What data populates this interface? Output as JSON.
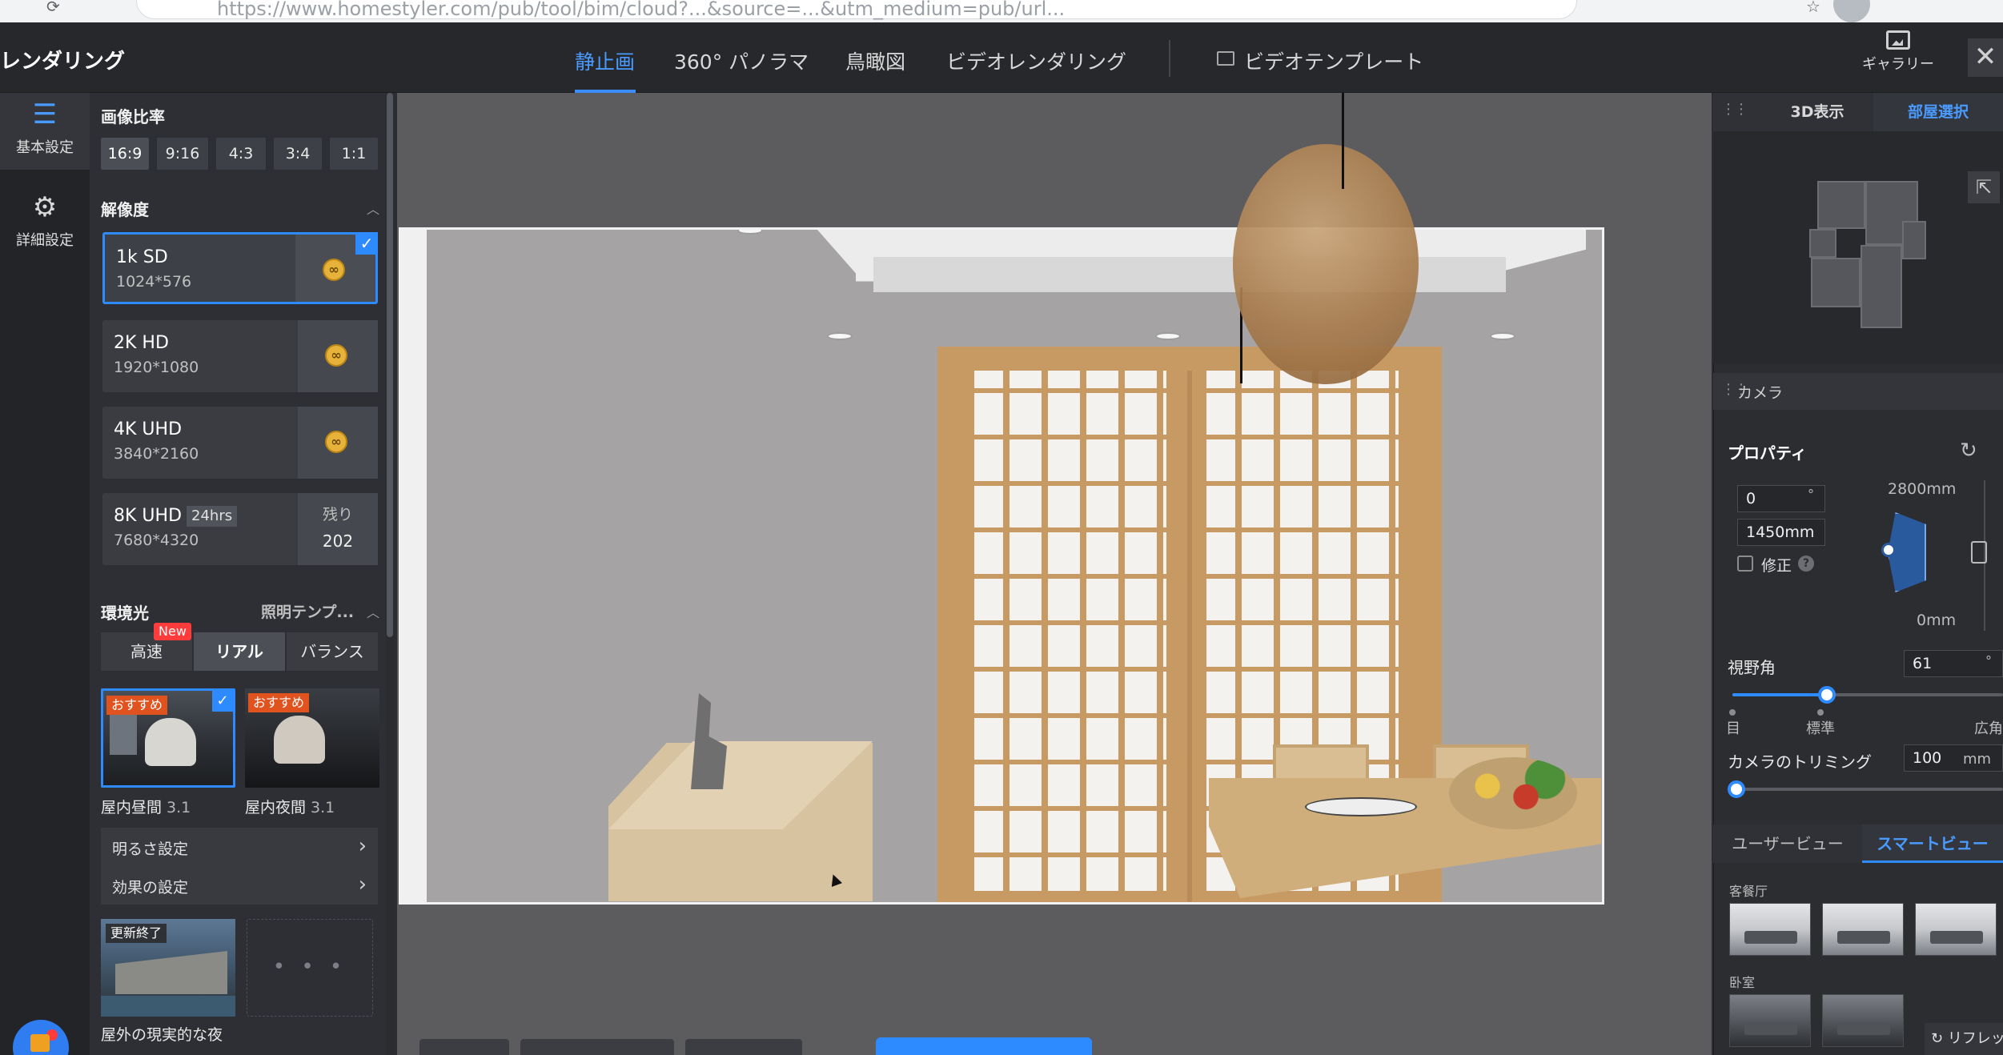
{
  "browser": {
    "url": "https://www.homestyler.com/pub/tool/bim/cloud?...&source=...&utm_medium=pub/url..."
  },
  "header": {
    "app_title": "レンダリング",
    "tabs": [
      "静止画",
      "360° パノラマ",
      "鳥瞰図",
      "ビデオレンダリング",
      "ビデオテンプレート"
    ],
    "active_tab": "静止画",
    "gallery_label": "ギャラリー",
    "close_symbol": "✕"
  },
  "rail": {
    "items": [
      {
        "label": "基本設定",
        "icon": "sliders-icon",
        "glyph": "☰",
        "active": true
      },
      {
        "label": "詳細設定",
        "icon": "gear-icon",
        "glyph": "⚙",
        "active": false
      }
    ]
  },
  "aspect": {
    "title": "画像比率",
    "options": [
      "16:9",
      "9:16",
      "4:3",
      "3:4",
      "1:1"
    ],
    "selected": "16:9"
  },
  "resolution": {
    "title": "解像度",
    "options": [
      {
        "name": "1k SD",
        "dims": "1024*576",
        "selected": true
      },
      {
        "name": "2K HD",
        "dims": "1920*1080",
        "selected": false
      },
      {
        "name": "4K UHD",
        "dims": "3840*2160",
        "selected": false
      },
      {
        "name": "8K UHD",
        "dims": "7680*4320",
        "tag": "24hrs",
        "remain_label": "残り",
        "remain_value": "202",
        "selected": false
      }
    ]
  },
  "lighting": {
    "title": "環境光",
    "template_link": "照明テンプ...",
    "modes": [
      "高速",
      "リアル",
      "バランス"
    ],
    "selected_mode": "リアル",
    "new_badge": "New",
    "presets": [
      {
        "tag": "おすすめ",
        "name": "屋内昼間",
        "version": "3.1",
        "selected": true
      },
      {
        "tag": "おすすめ",
        "name": "屋内夜間",
        "version": "3.1",
        "selected": false
      }
    ],
    "settings": [
      "明るさ設定",
      "効果の設定"
    ],
    "outdoor": {
      "tag": "更新終了",
      "name": "屋外の現実的な夜"
    },
    "more_symbol": "• • •"
  },
  "right": {
    "tabs": [
      "3D表示",
      "部屋選択"
    ],
    "active_tab": "部屋選択",
    "camera_title": "カメラ",
    "properties_title": "プロパティ",
    "angle_value": "0",
    "degree_unit": "°",
    "height_value": "1450mm",
    "max_height": "2800mm",
    "min_height": "0mm",
    "correction_label": "修正",
    "fov_label": "視野角",
    "fov_value": "61",
    "fov_ticks": [
      "目",
      "標準",
      "広角"
    ],
    "fov_fraction": 0.35,
    "trim_label": "カメラのトリミング",
    "trim_value": "100",
    "trim_unit": "mm",
    "trim_fraction": 0.0,
    "view_tabs": [
      "ユーザービュー",
      "スマートビュー"
    ],
    "active_view_tab": "スマートビュー",
    "categories": [
      "客餐厅",
      "卧室"
    ],
    "refresh_label": "リフレッシュ"
  },
  "colors": {
    "accent": "#2e8bff",
    "panel": "#2d2f34",
    "tag_orange": "#e0531f",
    "badge_red": "#ff3b3b"
  }
}
